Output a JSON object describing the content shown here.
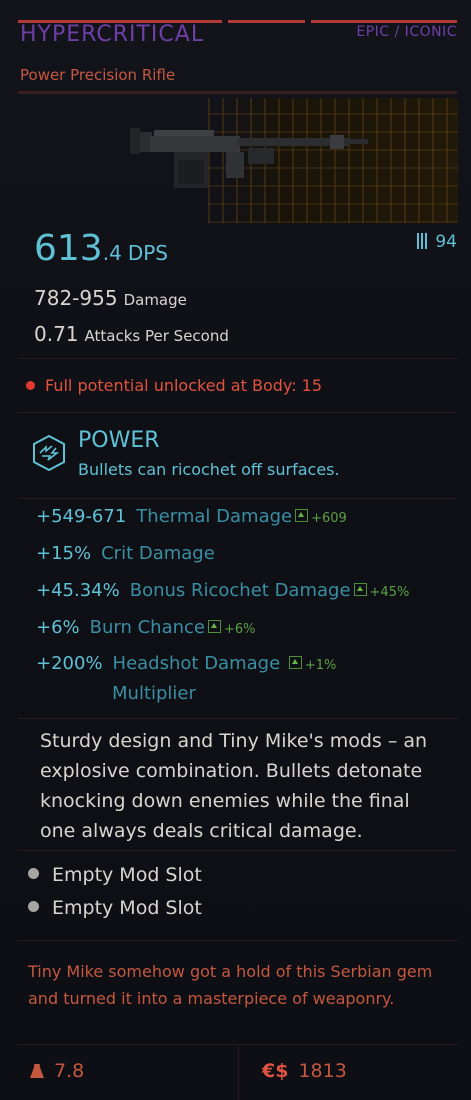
{
  "header": {
    "title": "HYPERCRITICAL",
    "rarity": "EPIC / ICONIC",
    "weapon_type": "Power Precision Rifle"
  },
  "stats": {
    "dps_int": "613",
    "dps_dec": ".4",
    "dps_unit": "DPS",
    "ammo": "94",
    "damage_value": "782-955",
    "damage_label": "Damage",
    "aps_value": "0.71",
    "aps_label": "Attacks Per Second"
  },
  "requirement": {
    "text": "Full potential unlocked at Body: 15"
  },
  "perk": {
    "name": "POWER",
    "description": "Bullets can ricochet off surfaces."
  },
  "bonuses": [
    {
      "value": "+549-671",
      "label": "Thermal Damage",
      "delta": "+609"
    },
    {
      "value": "+15%",
      "label": "Crit Damage",
      "delta": ""
    },
    {
      "value": "+45.34%",
      "label": "Bonus Ricochet Damage",
      "delta": "+45%"
    },
    {
      "value": "+6%",
      "label": "Burn Chance",
      "delta": "+6%"
    },
    {
      "value": "+200%",
      "label_line1": "Headshot Damage",
      "label_line2": "Multiplier",
      "delta": "+1%"
    }
  ],
  "description": "Sturdy design and Tiny Mike's mods – an explosive combination. Bullets detonate knocking down enemies while the final one always deals critical damage.",
  "mods": [
    {
      "label": "Empty Mod Slot"
    },
    {
      "label": "Empty Mod Slot"
    }
  ],
  "flavor": "Tiny Mike somehow got a hold of this Serbian gem and turned it into a masterpiece of weaponry.",
  "footer": {
    "weight": "7.8",
    "currency_symbol": "€$",
    "price": "1813"
  },
  "colors": {
    "rarity_purple": "#6f3fa7",
    "accent_red": "#c5573f",
    "stat_cyan": "#5fc1d6",
    "upgrade_green": "#5aa044",
    "warning_red": "#e2392e"
  },
  "icons": {
    "ammo": "ammo-icon",
    "perk": "power-perk-icon",
    "weight": "weight-icon",
    "upgrade": "upgrade-arrow-icon"
  }
}
